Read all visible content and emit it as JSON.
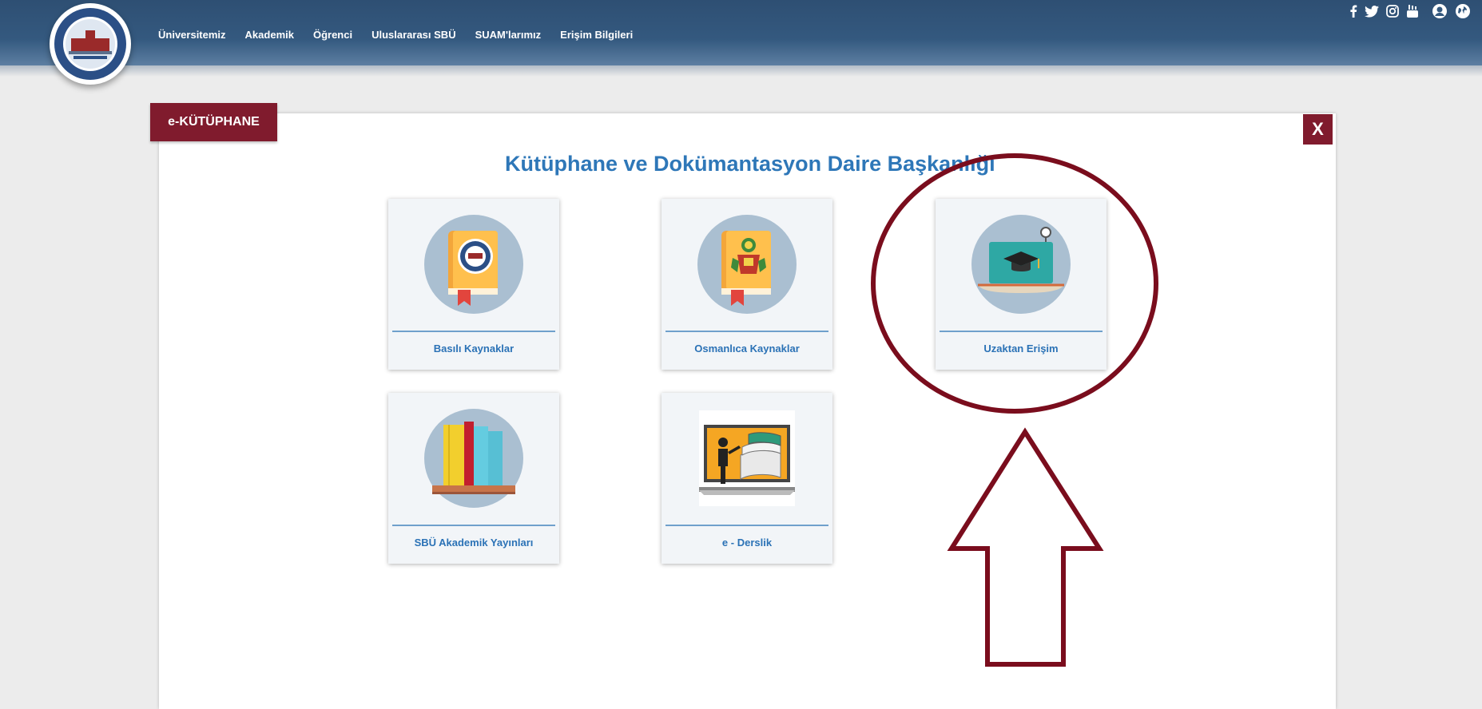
{
  "nav": {
    "items": [
      "Üniversitemiz",
      "Akademik",
      "Öğrenci",
      "Uluslararası SBÜ",
      "SUAM'larımız",
      "Erişim Bilgileri"
    ]
  },
  "social": {
    "icons": [
      "facebook-icon",
      "twitter-icon",
      "instagram-icon",
      "youtube-icon",
      "user-icon",
      "globe-icon"
    ]
  },
  "modal": {
    "tab_label": "e-KÜTÜPHANE",
    "close_label": "X",
    "title": "Kütüphane ve Dokümantasyon Daire Başkanlığı",
    "cards": [
      {
        "label": "Basılı Kaynaklar"
      },
      {
        "label": "Osmanlıca Kaynaklar"
      },
      {
        "label": "Uzaktan Erişim"
      },
      {
        "label": "SBÜ Akademik Yayınları"
      },
      {
        "label": "e - Derslik"
      }
    ]
  },
  "colors": {
    "header": "#34597f",
    "accent": "#801b2d",
    "title_blue": "#2e77b8",
    "annotation": "#7a0d1d"
  }
}
